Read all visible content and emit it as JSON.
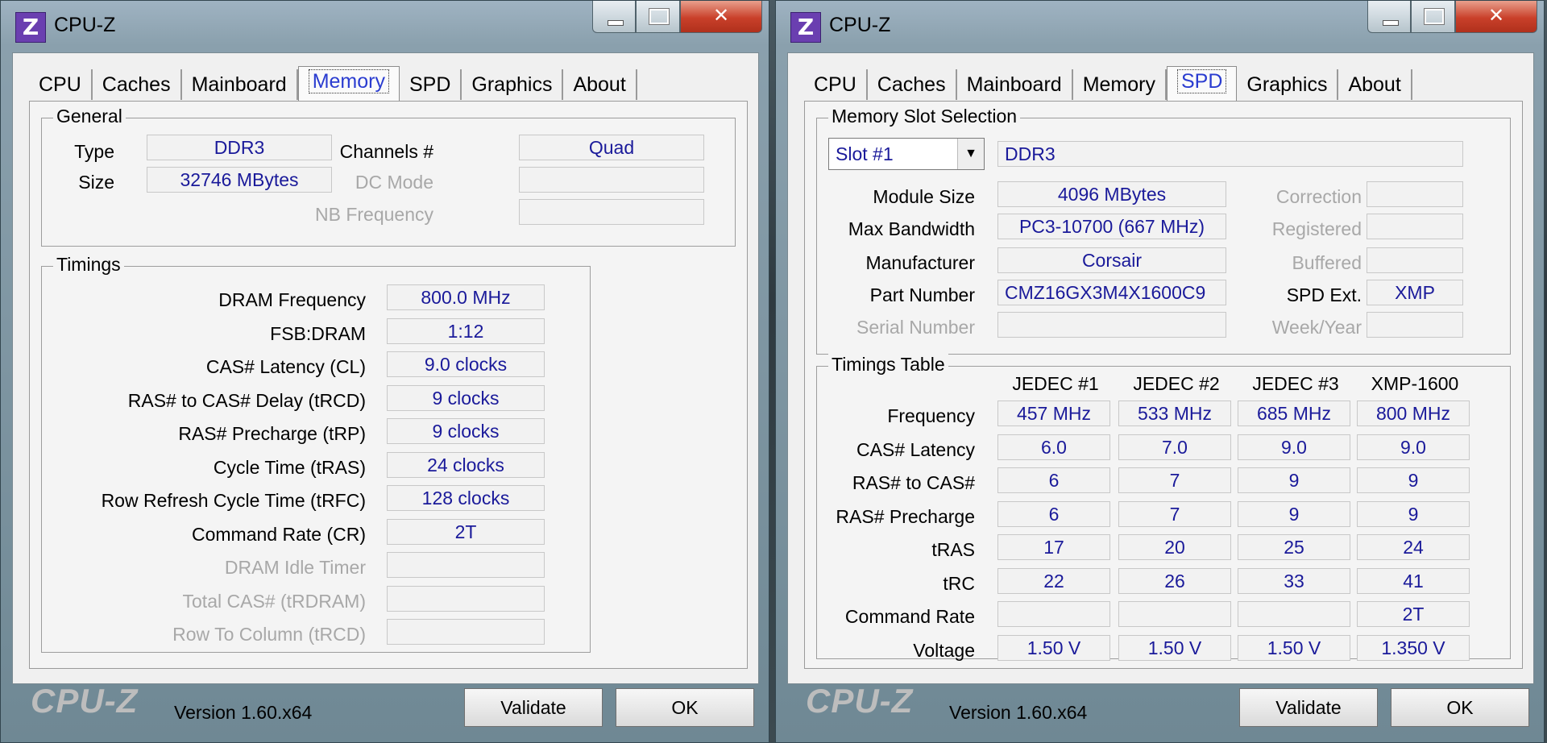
{
  "colors": {
    "accent": "#2a3cd0",
    "value_text": "#1a1a9a",
    "close_button": "#c9402a",
    "app_icon": "#6a3fb0"
  },
  "icons": {
    "app": "cpu-z-icon",
    "minimize": "minimize-icon",
    "maximize": "maximize-icon",
    "close": "close-icon",
    "dropdown": "chevron-down-icon"
  },
  "left": {
    "title": "CPU-Z",
    "app_icon_letter": "Z",
    "close_glyph": "✕",
    "tabs": [
      "CPU",
      "Caches",
      "Mainboard",
      "Memory",
      "SPD",
      "Graphics",
      "About"
    ],
    "active_tab": "Memory",
    "general": {
      "title": "General",
      "type_label": "Type",
      "type_value": "DDR3",
      "size_label": "Size",
      "size_value": "32746 MBytes",
      "channels_label": "Channels #",
      "channels_value": "Quad",
      "dc_mode_label": "DC Mode",
      "dc_mode_value": "",
      "nb_freq_label": "NB Frequency",
      "nb_freq_value": ""
    },
    "timings": {
      "title": "Timings",
      "rows": [
        {
          "label": "DRAM Frequency",
          "value": "800.0 MHz"
        },
        {
          "label": "FSB:DRAM",
          "value": "1:12"
        },
        {
          "label": "CAS# Latency (CL)",
          "value": "9.0 clocks"
        },
        {
          "label": "RAS# to CAS# Delay (tRCD)",
          "value": "9 clocks"
        },
        {
          "label": "RAS# Precharge (tRP)",
          "value": "9 clocks"
        },
        {
          "label": "Cycle Time (tRAS)",
          "value": "24 clocks"
        },
        {
          "label": "Row Refresh Cycle Time (tRFC)",
          "value": "128 clocks"
        },
        {
          "label": "Command Rate (CR)",
          "value": "2T"
        },
        {
          "label": "DRAM Idle Timer",
          "value": ""
        },
        {
          "label": "Total CAS# (tRDRAM)",
          "value": ""
        },
        {
          "label": "Row To Column (tRCD)",
          "value": ""
        }
      ]
    },
    "footer": {
      "logo": "CPU-Z",
      "version": "Version 1.60.x64",
      "validate": "Validate",
      "ok": "OK"
    }
  },
  "right": {
    "title": "CPU-Z",
    "app_icon_letter": "Z",
    "close_glyph": "✕",
    "tabs": [
      "CPU",
      "Caches",
      "Mainboard",
      "Memory",
      "SPD",
      "Graphics",
      "About"
    ],
    "active_tab": "SPD",
    "slot": {
      "title": "Memory Slot Selection",
      "selected_slot": "Slot #1",
      "slot_type": "DDR3",
      "module_size_label": "Module Size",
      "module_size_value": "4096 MBytes",
      "max_bw_label": "Max Bandwidth",
      "max_bw_value": "PC3-10700 (667 MHz)",
      "manufacturer_label": "Manufacturer",
      "manufacturer_value": "Corsair",
      "part_label": "Part Number",
      "part_value": "CMZ16GX3M4X1600C9",
      "serial_label": "Serial Number",
      "serial_value": "",
      "correction_label": "Correction",
      "correction_value": "",
      "registered_label": "Registered",
      "registered_value": "",
      "buffered_label": "Buffered",
      "buffered_value": "",
      "spd_ext_label": "SPD Ext.",
      "spd_ext_value": "XMP",
      "week_year_label": "Week/Year",
      "week_year_value": ""
    },
    "timings_table": {
      "title": "Timings Table",
      "columns": [
        "JEDEC #1",
        "JEDEC #2",
        "JEDEC #3",
        "XMP-1600"
      ],
      "rows": [
        {
          "label": "Frequency",
          "values": [
            "457 MHz",
            "533 MHz",
            "685 MHz",
            "800 MHz"
          ]
        },
        {
          "label": "CAS# Latency",
          "values": [
            "6.0",
            "7.0",
            "9.0",
            "9.0"
          ]
        },
        {
          "label": "RAS# to CAS#",
          "values": [
            "6",
            "7",
            "9",
            "9"
          ]
        },
        {
          "label": "RAS# Precharge",
          "values": [
            "6",
            "7",
            "9",
            "9"
          ]
        },
        {
          "label": "tRAS",
          "values": [
            "17",
            "20",
            "25",
            "24"
          ]
        },
        {
          "label": "tRC",
          "values": [
            "22",
            "26",
            "33",
            "41"
          ]
        },
        {
          "label": "Command Rate",
          "values": [
            "",
            "",
            "",
            "2T"
          ]
        },
        {
          "label": "Voltage",
          "values": [
            "1.50 V",
            "1.50 V",
            "1.50 V",
            "1.350 V"
          ]
        }
      ]
    },
    "footer": {
      "logo": "CPU-Z",
      "version": "Version 1.60.x64",
      "validate": "Validate",
      "ok": "OK"
    }
  }
}
